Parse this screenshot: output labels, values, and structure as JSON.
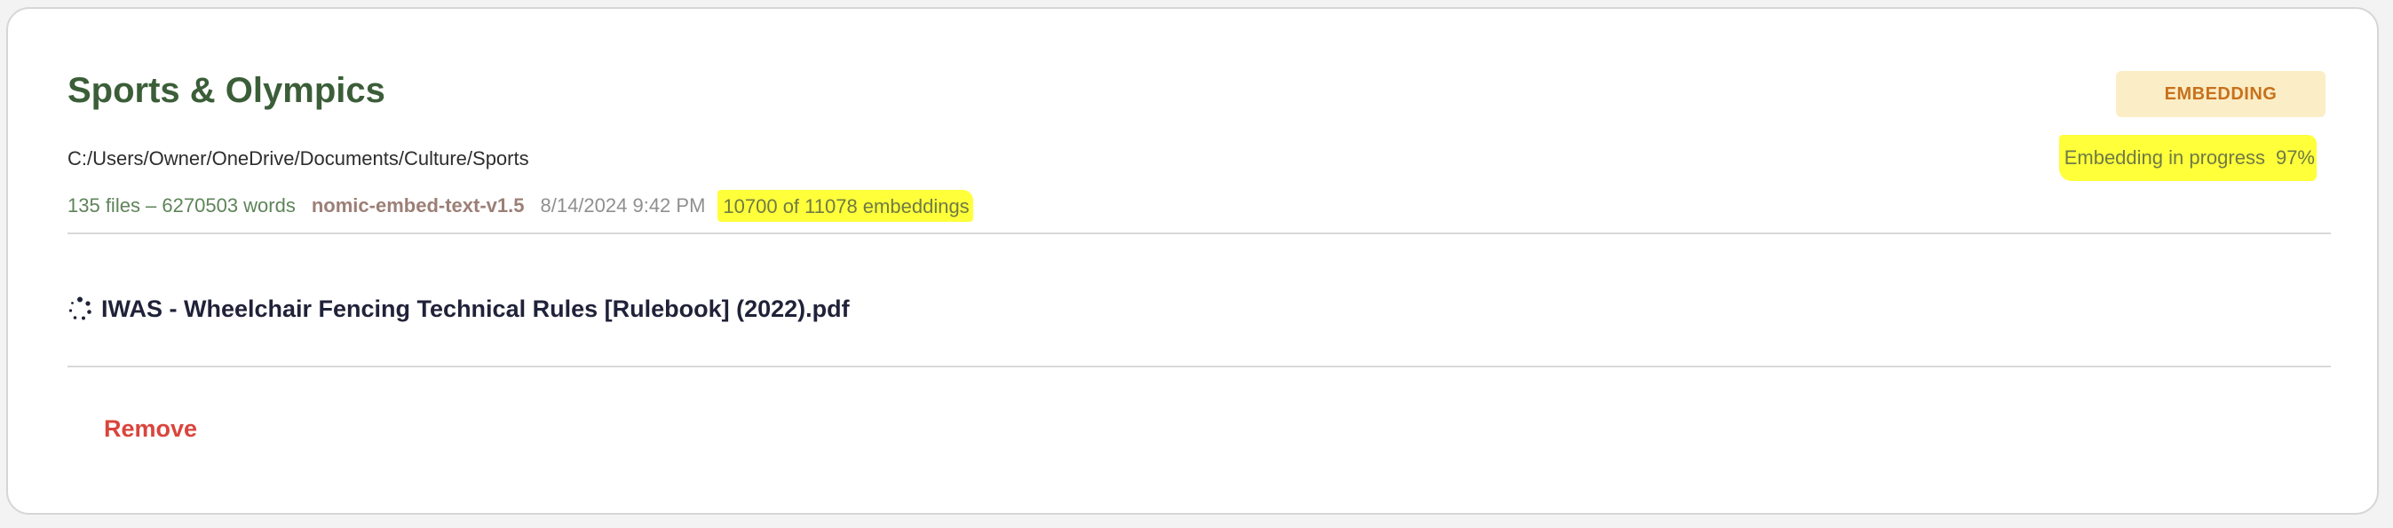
{
  "collection": {
    "name": "Sports & Olympics",
    "status_badge": "EMBEDDING",
    "path": "C:/Users/Owner/OneDrive/Documents/Culture/Sports",
    "progress": {
      "label": "Embedding in progress",
      "percent_text": "97%",
      "percent": 97
    },
    "file_stats": "135 files – 6270503 words",
    "model": "nomic-embed-text-v1.5",
    "date": "8/14/2024 9:42 PM",
    "embeddings": "10700 of 11078 embeddings",
    "current_file": {
      "icon": "loading-spinner-icon",
      "name": "IWAS - Wheelchair Fencing Technical Rules [Rulebook] (2022).pdf"
    },
    "actions": {
      "remove_label": "Remove"
    }
  },
  "colors": {
    "title": "#3b5e38",
    "badge_bg": "#fbedc6",
    "badge_text": "#c8711b",
    "highlight": "#ffff3a",
    "remove": "#d9453d"
  }
}
